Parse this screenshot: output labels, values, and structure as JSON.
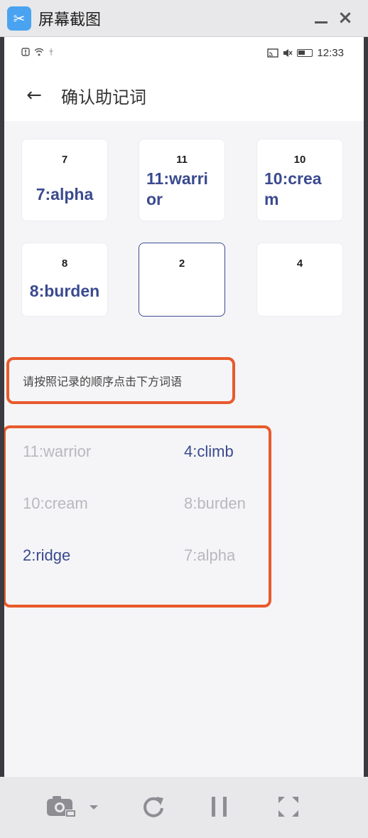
{
  "window": {
    "title": "屏幕截图",
    "logo_icon": "scissors-icon",
    "minimize_icon": "minimize-icon",
    "close_icon": "close-icon",
    "close_glyph": "×"
  },
  "status_bar": {
    "time": "12:33",
    "left_icons": [
      "notification-icon",
      "wifi-icon",
      "usb-icon"
    ],
    "right_icons": [
      "cast-icon",
      "mute-icon",
      "battery-icon"
    ]
  },
  "app_bar": {
    "back_icon": "back-arrow-icon",
    "back_glyph": "←",
    "title": "确认助记词"
  },
  "slots": [
    {
      "number": "7",
      "word": "7:alpha",
      "active": false
    },
    {
      "number": "11",
      "word": "11:warrior",
      "active": false
    },
    {
      "number": "10",
      "word": "10:cream",
      "active": false
    },
    {
      "number": "8",
      "word": "8:burden",
      "active": false
    },
    {
      "number": "2",
      "word": "",
      "active": true
    },
    {
      "number": "4",
      "word": "",
      "active": false
    }
  ],
  "hint": "请按照记录的顺序点击下方词语",
  "word_options": [
    {
      "text": "11:warrior",
      "state": "used"
    },
    {
      "text": "4:climb",
      "state": "available"
    },
    {
      "text": "10:cream",
      "state": "used"
    },
    {
      "text": "8:burden",
      "state": "used"
    },
    {
      "text": "2:ridge",
      "state": "available"
    },
    {
      "text": "7:alpha",
      "state": "used"
    }
  ],
  "toolbar": {
    "items": [
      "camera-icon",
      "refresh-icon",
      "pause-icon",
      "fullscreen-icon"
    ]
  },
  "colors": {
    "accent": "#3a4a8f",
    "highlight_border": "#e85a2c",
    "used_word": "#b8b8be"
  }
}
